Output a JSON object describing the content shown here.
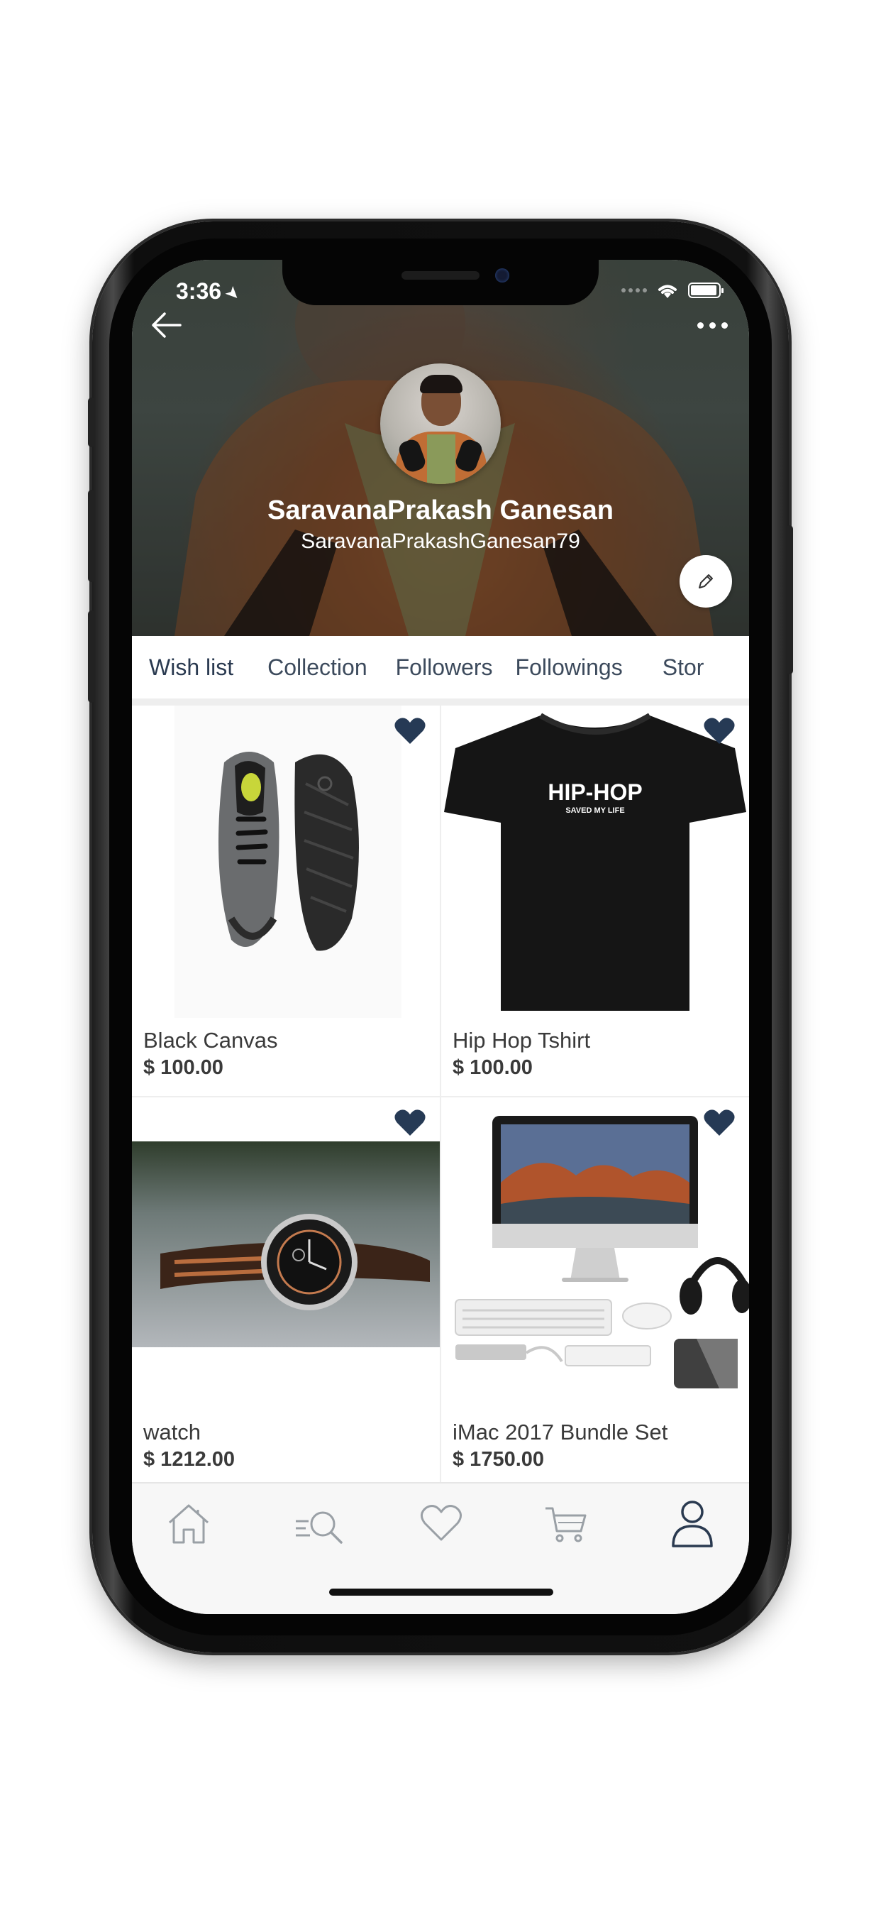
{
  "status_bar": {
    "time": "3:36",
    "location_icon": "location-arrow-icon",
    "icons": [
      "signal-icon",
      "wifi-icon",
      "battery-icon"
    ]
  },
  "header": {
    "back_icon": "back-arrow-icon",
    "more_icon": "more-dots-icon",
    "name": "SaravanaPrakash Ganesan",
    "username": "SaravanaPrakashGanesan79",
    "edit_icon": "pencil-icon"
  },
  "tabs": [
    {
      "label": "Wish list",
      "active": true
    },
    {
      "label": "Collection",
      "active": false
    },
    {
      "label": "Followers",
      "active": false
    },
    {
      "label": "Followings",
      "active": false
    },
    {
      "label": "Stor",
      "active": false
    }
  ],
  "products": [
    {
      "name": "Black Canvas",
      "price": "$ 100.00",
      "image": "sneakers",
      "favorited": true
    },
    {
      "name": "Hip Hop Tshirt",
      "price": "$ 100.00",
      "image": "black-tshirt",
      "favorited": true,
      "image_text": "HIP-HOP",
      "image_subtext": "SAVED MY LIFE"
    },
    {
      "name": "watch",
      "price": "$ 1212.00",
      "image": "wrist-watch",
      "favorited": true
    },
    {
      "name": "iMac 2017 Bundle Set",
      "price": "$ 1750.00",
      "image": "imac-bundle",
      "favorited": true
    }
  ],
  "tab_bar": [
    {
      "icon": "home-icon",
      "active": false
    },
    {
      "icon": "search-list-icon",
      "active": false
    },
    {
      "icon": "heart-icon",
      "active": false
    },
    {
      "icon": "cart-icon",
      "active": false
    },
    {
      "icon": "profile-icon",
      "active": true
    }
  ],
  "colors": {
    "accent": "#2a3a50",
    "heart": "#263a55",
    "tab_inactive": "#9aa0a6",
    "divider": "#eeeeee"
  }
}
